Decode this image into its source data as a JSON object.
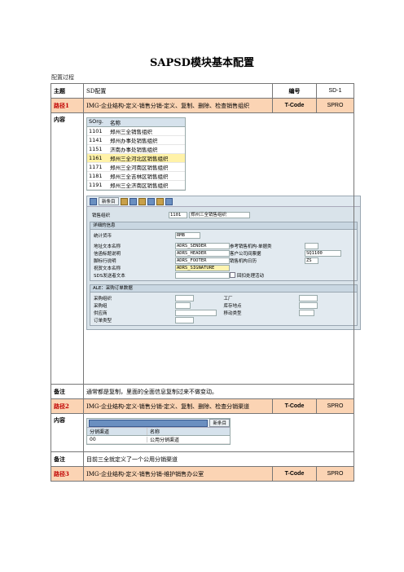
{
  "title": "SAPSD模块基本配置",
  "subtitle": "配置过程",
  "table": {
    "row1": {
      "label": "主题",
      "value": "SD配置",
      "code_label": "编号",
      "code_value": "SD-1"
    },
    "row2": {
      "label": "路径1",
      "value": "IMG-企业结构-定义-销售分销-定义、复制、删除、检查销售组织",
      "tcode_label": "T-Code",
      "tcode_value": "SPRO"
    },
    "row3": {
      "label": "内容"
    },
    "row4": {
      "label": "备注",
      "value": "通常都是复制，里面的全面信息复制过来不做变动。"
    },
    "row5": {
      "label": "路径2",
      "value": "IMG-企业结构-定义-销售分销-定义、复制、删除、检查分销渠道",
      "tcode_label": "T-Code",
      "tcode_value": "SPRO"
    },
    "row6": {
      "label": "内容"
    },
    "row7": {
      "label": "备注",
      "value": "目前三全就定义了一个公用分销渠道"
    },
    "row8": {
      "label": "路径3",
      "value": "IMG-企业结构-定义-销售分销-维护销售办公室",
      "tcode_label": "T-Code",
      "tcode_value": "SPRO"
    }
  },
  "orglist": {
    "headers": [
      "SOrg.",
      "名称"
    ],
    "rows": [
      {
        "code": "1101",
        "name": "郑州三全销售组织"
      },
      {
        "code": "1141",
        "name": "郑州办事处销售组织"
      },
      {
        "code": "1151",
        "name": "济南办事处销售组织"
      },
      {
        "code": "1161",
        "name": "郑州三全河北区销售组织"
      },
      {
        "code": "1171",
        "name": "郑州三全河南区销售组织"
      },
      {
        "code": "1181",
        "name": "郑州三全吉林区销售组织"
      },
      {
        "code": "1191",
        "name": "郑州三全济南区销售组织"
      }
    ],
    "selected_index": 3
  },
  "sap": {
    "new_entry": "新条目",
    "org_label": "销售组织",
    "org_code": "1101",
    "org_name": "郑州三全销售组织",
    "detail_header": "详细的信息",
    "currency_label": "统计货币",
    "currency_value": "RMB",
    "addr_label": "地址文本名称",
    "addr_value": "ADRS_SENDER",
    "letter_label": "信函标题说明",
    "letter_value": "ADRS_HEADER",
    "footer_label": "脚标行说明",
    "footer_value": "ADRS_FOOTER",
    "greet_label": "祝贺文本名称",
    "greet_value": "ADRS_SIGNATURE",
    "sds_label": "SDS发送者文本",
    "ref_label": "参考销售机构-单据类",
    "cust_label": "客户公司间票据",
    "cust_value": "SQ1100",
    "cal_label": "销售机构日历",
    "cal_value": "ZS",
    "rebate_label": "回扣处理活动",
    "ale_header": "ALE：采购订单数据",
    "purch_org": "采购组织",
    "purch_group": "采购组",
    "vendor": "供应商",
    "order_type": "订单类型",
    "plant": "工厂",
    "sloc": "库存地点",
    "movement": "移动类型"
  },
  "channel": {
    "new_entry": "新条目",
    "headers": [
      "分销渠道",
      "名称"
    ],
    "rows": [
      {
        "code": "00",
        "name": "公用分销渠道"
      }
    ]
  },
  "colors": {
    "path_bg": "#fbd4b4",
    "path_label": "#c00000",
    "selected_row": "#fff2a8"
  }
}
